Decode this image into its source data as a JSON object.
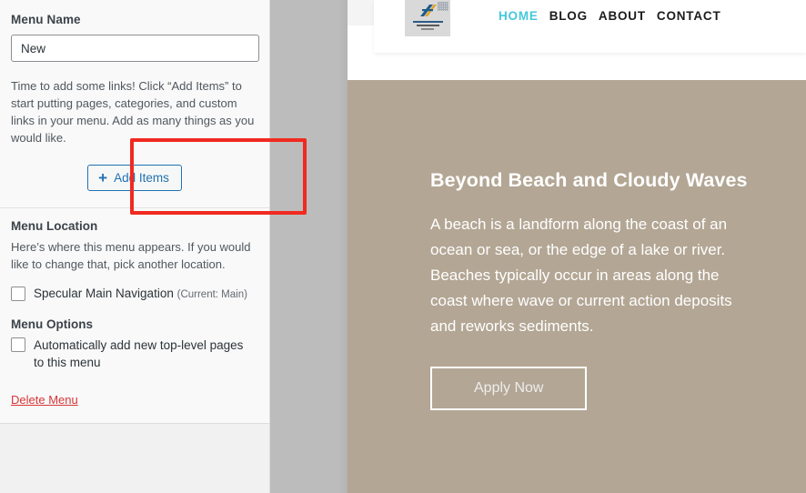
{
  "customizer": {
    "menu_name": {
      "label": "Menu Name",
      "value": "New",
      "placeholder": "Menu Name"
    },
    "help_text": "Time to add some links! Click “Add Items” to start putting pages, categories, and custom links in your menu. Add as many things as you would like.",
    "add_items_button": {
      "label": "Add Items",
      "icon": "plus-icon"
    },
    "menu_location": {
      "heading": "Menu Location",
      "description": "Here’s where this menu appears. If you would like to change that, pick another location.",
      "checkbox_label": "Specular Main Navigation",
      "current_note": "(Current: Main)",
      "checked": false
    },
    "menu_options": {
      "heading": "Menu Options",
      "checkbox_label": "Automatically add new top-level pages to this menu",
      "checked": false
    },
    "delete_menu_link": "Delete Menu"
  },
  "annotation": {
    "highlight_color": "#f02a20",
    "target": "add-items-button"
  },
  "preview": {
    "site_header": {
      "logo_alt": "site-logo",
      "nav_items": [
        {
          "label": "HOME",
          "active": true
        },
        {
          "label": "BLOG",
          "active": false
        },
        {
          "label": "ABOUT",
          "active": false
        },
        {
          "label": "CONTACT",
          "active": false
        }
      ],
      "active_color": "#45c7dd",
      "link_color": "#1c1c1c"
    },
    "hero": {
      "background_color": "#b3a694",
      "title": "Beyond Beach and Cloudy Waves",
      "body": "A beach is a landform along the coast of an ocean or sea, or the edge of a lake or river. Beaches typically occur in areas along the coast where wave or current action deposits and reworks sediments.",
      "cta_label": "Apply Now"
    }
  }
}
